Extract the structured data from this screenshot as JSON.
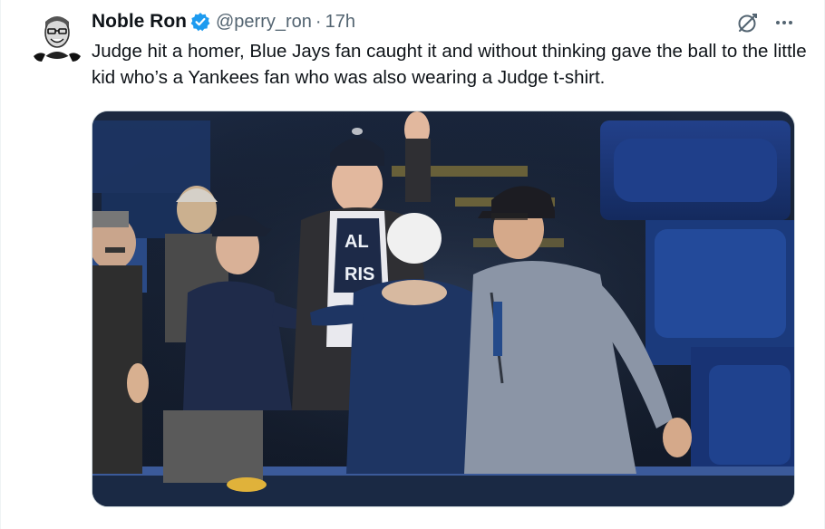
{
  "tweet": {
    "author": {
      "display_name": "Noble Ron",
      "handle": "@perry_ron",
      "verified": true,
      "avatar_icon": "avatar-portrait"
    },
    "separator": "·",
    "time": "17h",
    "text": "Judge hit a homer, Blue Jays fan caught it and without thinking gave the ball to the little kid who’s a Yankees fan who was also wearing a Judge t-shirt.",
    "actions": {
      "grok_icon": "grok-icon",
      "more_icon": "more-icon"
    },
    "media": {
      "type": "video-still",
      "shirt_text": "AL\nRIS"
    },
    "colors": {
      "verified_blue": "#1d9bf0",
      "secondary_text": "#536471",
      "primary_text": "#0f1419"
    }
  }
}
